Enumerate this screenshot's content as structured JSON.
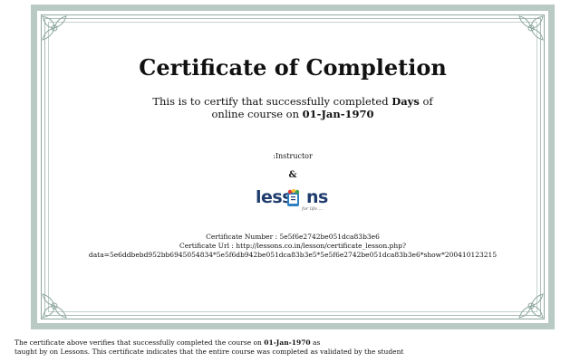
{
  "certificate": {
    "title": "Certificate of Completion",
    "intro_prefix": "This is to certify that successfully completed",
    "course_name": "Days",
    "intro_suffix": "of",
    "line2_prefix": "online course on",
    "completion_date": "01-Jan-1970",
    "instructor_label": ":Instructor",
    "ampersand": "&",
    "logo": {
      "text_a": "less",
      "text_b": "ns",
      "tagline": "for life...."
    },
    "number_label": "Certificate Number : 5e5f6e2742be051dca83b3e6",
    "url_label": "Certificate Url : http://lessons.co.in/lesson/certificate_lesson.php?",
    "url_data": "data=5e6ddbebd952bb6945054834*5e5f6db942be051dca83b3e5*5e5f6e2742be051dca83b3e6*show*200410123215"
  },
  "footer": {
    "line1_prefix": "The certificate above verifies that successfully completed the course on",
    "line1_date": "01-Jan-1970",
    "line1_suffix": "as",
    "line2": "taught by on Lessons. This certificate indicates that the entire course was completed as validated by the student"
  },
  "colors": {
    "border": "#b9c9c3",
    "logo_text": "#1f3c6e"
  }
}
